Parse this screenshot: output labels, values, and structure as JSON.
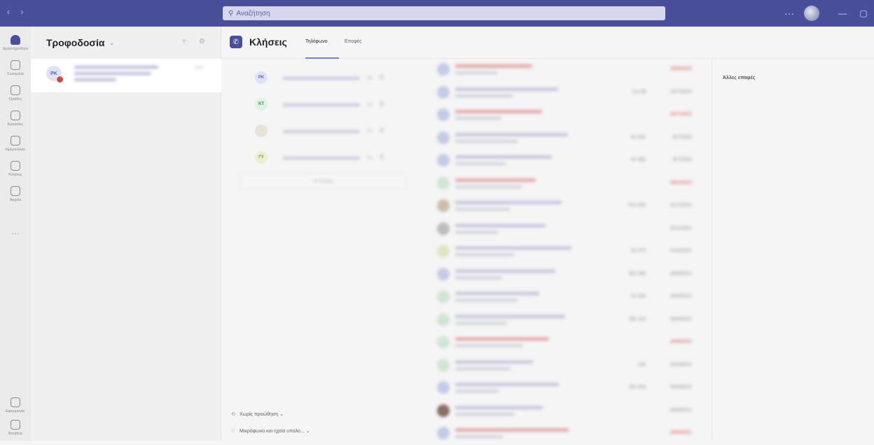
{
  "window": {
    "nav_arrows": "‹ ›",
    "search_placeholder": "Αναζήτηση",
    "more_label": "···",
    "minimize": "—",
    "maximize": "▢"
  },
  "rail": {
    "items": [
      {
        "label": "Δραστηριότητα",
        "icon": "bell-icon"
      },
      {
        "label": "Συνομιλία",
        "icon": "chat-icon"
      },
      {
        "label": "Ομάδες",
        "icon": "teams-icon"
      },
      {
        "label": "Εργασίες",
        "icon": "assignments-icon"
      },
      {
        "label": "Ημερολόγιο",
        "icon": "calendar-icon"
      },
      {
        "label": "Κλήσεις",
        "icon": "phone-icon"
      },
      {
        "label": "Αρχεία",
        "icon": "file-icon"
      }
    ],
    "more": "···",
    "bottom_items": [
      {
        "label": "Εφαρμογές",
        "icon": "apps-icon"
      },
      {
        "label": "Βοήθεια",
        "icon": "help-icon"
      }
    ]
  },
  "list": {
    "title": "Τροφοδοσία",
    "caret": "⌄",
    "actions": "▿ ⚙",
    "chat": {
      "initials": "PK",
      "time": "13:0"
    }
  },
  "main": {
    "title": "Κλήσεις",
    "tabs": [
      "Τηλέφωνο",
      "Επαφές"
    ],
    "contacts": [
      {
        "initials": "PK",
        "bg": "#dfe3f6",
        "fg": "#5b63b6"
      },
      {
        "initials": "KT",
        "bg": "#dff2e3",
        "fg": "#3f8a52"
      },
      {
        "initials": "",
        "bg": "#e8e3d6",
        "fg": "#6b5a3a"
      },
      {
        "initials": "ΓΥ",
        "bg": "#ecf0d3",
        "fg": "#7a8a2a"
      }
    ],
    "call_button": "✆ Κλήση",
    "settings": [
      {
        "icon": "⟲",
        "label": "Χωρίς προώθηση",
        "caret": "⌄"
      },
      {
        "icon": "♡",
        "label": "Μικρόφωνο και ηχεία υπολο...",
        "caret": "⌄"
      }
    ],
    "right_title": "Άλλες επαφές"
  },
  "history": [
    {
      "dur": "",
      "date": "19/8/2022",
      "missed": true,
      "av": "#c4cbe8",
      "l1": "#e8a9a9"
    },
    {
      "dur": "1ω 08",
      "date": "24/7/2022",
      "missed": false,
      "av": "#c4cbe8",
      "l1": "#c6c8dd"
    },
    {
      "dur": "",
      "date": "24/7/2022",
      "missed": true,
      "av": "#c4cbe8",
      "l1": "#e8a9a9"
    },
    {
      "dur": "4λ 45δ",
      "date": "8/7/2022",
      "missed": false,
      "av": "#c4cbe8",
      "l1": "#c6c8dd"
    },
    {
      "dur": "4λ 49δ",
      "date": "8/7/2022",
      "missed": false,
      "av": "#c4cbe8",
      "l1": "#c6c8dd"
    },
    {
      "dur": "",
      "date": "29/4/2022",
      "missed": true,
      "av": "#cfe6d4",
      "l1": "#e8a9a9"
    },
    {
      "dur": "51λ 40δ",
      "date": "4/12/2021",
      "missed": false,
      "av": "#cbbfa8",
      "l1": "#c6c8dd"
    },
    {
      "dur": "",
      "date": "8/11/2021",
      "missed": false,
      "av": "#bdbdbd",
      "l1": "#c6c8dd"
    },
    {
      "dur": "3λ 37δ",
      "date": "4/10/2021",
      "missed": false,
      "av": "#dfe6c6",
      "l1": "#c6c8dd"
    },
    {
      "dur": "35λ 28δ",
      "date": "28/9/2021",
      "missed": false,
      "av": "#c4cbe8",
      "l1": "#c6c8dd"
    },
    {
      "dur": "2λ 33δ",
      "date": "28/9/2021",
      "missed": false,
      "av": "#cfe6d4",
      "l1": "#c6c8dd"
    },
    {
      "dur": "26λ 11δ",
      "date": "28/9/2021",
      "missed": false,
      "av": "#cfe6d4",
      "l1": "#c6c8dd"
    },
    {
      "dur": "",
      "date": "28/9/2021",
      "missed": true,
      "av": "#cfe6d4",
      "l1": "#e8a9a9"
    },
    {
      "dur": "14δ",
      "date": "28/9/2021",
      "missed": false,
      "av": "#cfe6d4",
      "l1": "#c6c8dd"
    },
    {
      "dur": "15λ 32δ",
      "date": "28/9/2021",
      "missed": false,
      "av": "#c4cbe8",
      "l1": "#c6c8dd"
    },
    {
      "dur": "",
      "date": "28/9/2021",
      "missed": false,
      "av": "#8a6f62",
      "l1": "#c6c8dd"
    },
    {
      "dur": "",
      "date": "28/9/2021",
      "missed": true,
      "av": "#c4cbe8",
      "l1": "#e8a9a9"
    }
  ]
}
